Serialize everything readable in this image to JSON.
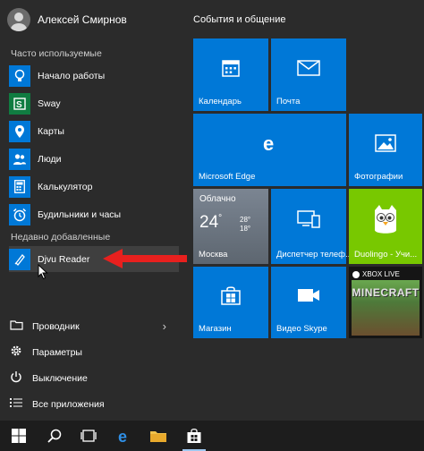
{
  "user": {
    "name": "Алексей Смирнов"
  },
  "left": {
    "frequent_label": "Часто используемые",
    "frequent_apps": [
      {
        "label": "Начало работы",
        "icon": "lightbulb-icon"
      },
      {
        "label": "Sway",
        "icon": "sway-icon"
      },
      {
        "label": "Карты",
        "icon": "maps-icon"
      },
      {
        "label": "Люди",
        "icon": "people-icon"
      },
      {
        "label": "Калькулятор",
        "icon": "calculator-icon"
      },
      {
        "label": "Будильники и часы",
        "icon": "alarm-icon"
      }
    ],
    "recent_label": "Недавно добавленные",
    "recent_apps": [
      {
        "label": "Djvu Reader",
        "icon": "djvu-icon"
      }
    ],
    "bottom": [
      {
        "label": "Проводник",
        "icon": "folder-icon"
      },
      {
        "label": "Параметры",
        "icon": "gear-icon"
      },
      {
        "label": "Выключение",
        "icon": "power-icon"
      },
      {
        "label": "Все приложения",
        "icon": "list-icon"
      }
    ]
  },
  "tiles": {
    "group_title": "События и общение",
    "calendar": "Календарь",
    "mail": "Почта",
    "edge": "Microsoft Edge",
    "photos": "Фотографии",
    "weather": {
      "condition": "Облачно",
      "temp": "24",
      "unit": "°",
      "high": "28°",
      "low": "18°",
      "city": "Москва"
    },
    "task_manager": "Диспетчер телеф...",
    "duolingo": "Duolingo - Учи...",
    "store": "Магазин",
    "skype": "Видео Skype",
    "xbox": {
      "badge": "XBOX LIVE",
      "game": "MINECRAFT"
    }
  },
  "colors": {
    "accent": "#0078d7",
    "menu_bg": "#2b2b2b",
    "taskbar_bg": "#1d1d1d",
    "arrow": "#e8201e",
    "duolingo": "#78c800"
  }
}
